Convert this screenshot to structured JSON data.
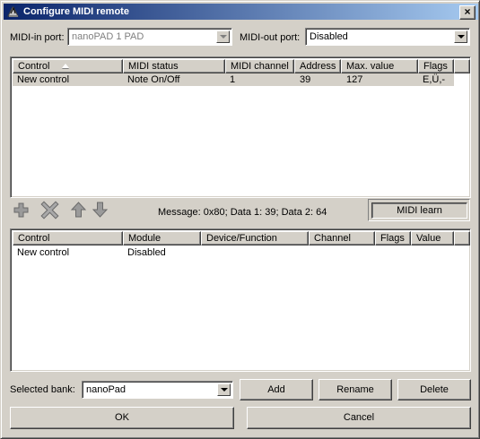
{
  "window": {
    "title": "Configure MIDI remote",
    "close_glyph": "×"
  },
  "ports": {
    "midi_in_label": "MIDI-in port:",
    "midi_in_value": "nanoPAD 1 PAD",
    "midi_out_label": "MIDI-out port:",
    "midi_out_value": "Disabled"
  },
  "midi_table": {
    "columns": [
      "Control",
      "MIDI status",
      "MIDI channel",
      "Address",
      "Max. value",
      "Flags"
    ],
    "rows": [
      [
        "New control",
        "Note On/Off",
        "1",
        "39",
        "127",
        "E,Ü,-"
      ]
    ]
  },
  "toolbar": {
    "add_icon": "plus-icon",
    "delete_icon": "x-icon",
    "up_icon": "arrow-up-icon",
    "down_icon": "arrow-down-icon",
    "message": "Message: 0x80; Data 1: 39; Data 2: 64",
    "midi_learn_label": "MIDI learn"
  },
  "target_table": {
    "columns": [
      "Control",
      "Module",
      "Device/Function",
      "Channel",
      "Flags",
      "Value"
    ],
    "rows": [
      [
        "New control",
        "Disabled",
        "",
        "",
        "",
        ""
      ]
    ]
  },
  "bank": {
    "label": "Selected bank:",
    "value": "nanoPad",
    "add_label": "Add",
    "rename_label": "Rename",
    "delete_label": "Delete"
  },
  "footer": {
    "ok_label": "OK",
    "cancel_label": "Cancel"
  },
  "colors": {
    "face": "#d4d0c8",
    "title_start": "#0a246a",
    "title_end": "#a6caf0",
    "disabled_icon": "#808080"
  }
}
